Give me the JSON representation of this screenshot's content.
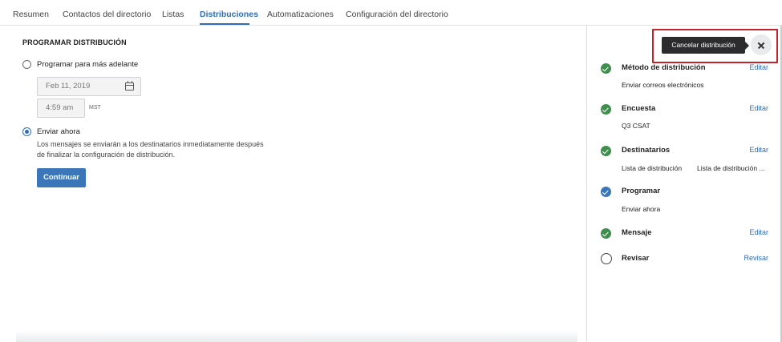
{
  "tabs": [
    {
      "label": "Resumen"
    },
    {
      "label": "Contactos del directorio"
    },
    {
      "label": "Listas"
    },
    {
      "label": "Distribuciones"
    },
    {
      "label": "Automatizaciones"
    },
    {
      "label": "Configuración del directorio"
    }
  ],
  "active_tab": "Distribuciones",
  "schedule": {
    "title": "PROGRAMAR DISTRIBUCIÓN",
    "option_later": "Programar para más adelante",
    "date_value": "Feb 11, 2019",
    "time_value": "4:59 am",
    "timezone": "MST",
    "option_now": "Enviar ahora",
    "description_line1": "Los mensajes se enviarán a los destinatarios inmediatamente después",
    "description_line2": "de finalizar la configuración de distribución.",
    "continue_label": "Continuar",
    "selected_option": "Enviar ahora"
  },
  "tooltip": "Cancelar distribución",
  "steps": [
    {
      "title": "Método de distribución",
      "subtitle": "Enviar correos electrónicos",
      "link": "Editar",
      "status": "complete"
    },
    {
      "title": "Encuesta",
      "subtitle": "Q3 CSAT",
      "link": "Editar",
      "status": "complete"
    },
    {
      "title": "Destinatarios",
      "subtitle": "Lista de distribución",
      "subtitle_value": "Lista de distribución ...",
      "link": "Editar",
      "status": "complete"
    },
    {
      "title": "Programar",
      "subtitle": "Enviar ahora",
      "link": "",
      "status": "current"
    },
    {
      "title": "Mensaje",
      "subtitle": "",
      "link": "Editar",
      "status": "complete"
    },
    {
      "title": "Revisar",
      "subtitle": "",
      "link": "Revisar",
      "status": "pending"
    }
  ],
  "colors": {
    "accent": "#2f6db5",
    "primary_button": "#3a76b8",
    "complete": "#3f8e4e",
    "highlight": "#c0242c",
    "tooltip_bg": "#2c2c2e"
  },
  "icons": {
    "calendar": "calendar-icon",
    "close": "close-icon",
    "check": "check-circle-icon",
    "pending": "empty-circle-icon"
  }
}
